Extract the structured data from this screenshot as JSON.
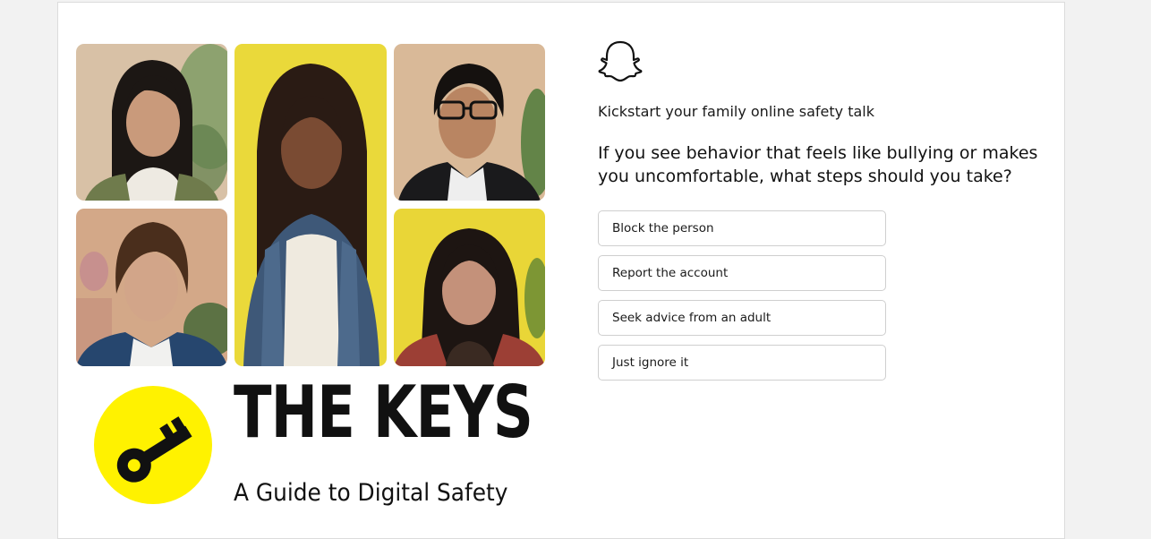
{
  "quiz": {
    "kicker": "Kickstart your family online safety talk",
    "question": "If you see behavior that feels like bullying or makes you uncomfortable, what steps should you take?",
    "answers": [
      "Block the person",
      "Report the account",
      "Seek advice from an adult",
      "Just ignore it"
    ]
  },
  "brand": {
    "title": "THE KEYS",
    "subtitle": "A Guide to Digital Safety",
    "accent": "#fff200"
  },
  "icons": {
    "brand_logo": "snapchat-ghost-icon",
    "key": "key-icon"
  },
  "photos": [
    "portrait-woman-green-sweater",
    "portrait-woman-denim-jacket",
    "portrait-man-glasses",
    "portrait-man-blue-jacket",
    "portrait-woman-red-jacket"
  ]
}
